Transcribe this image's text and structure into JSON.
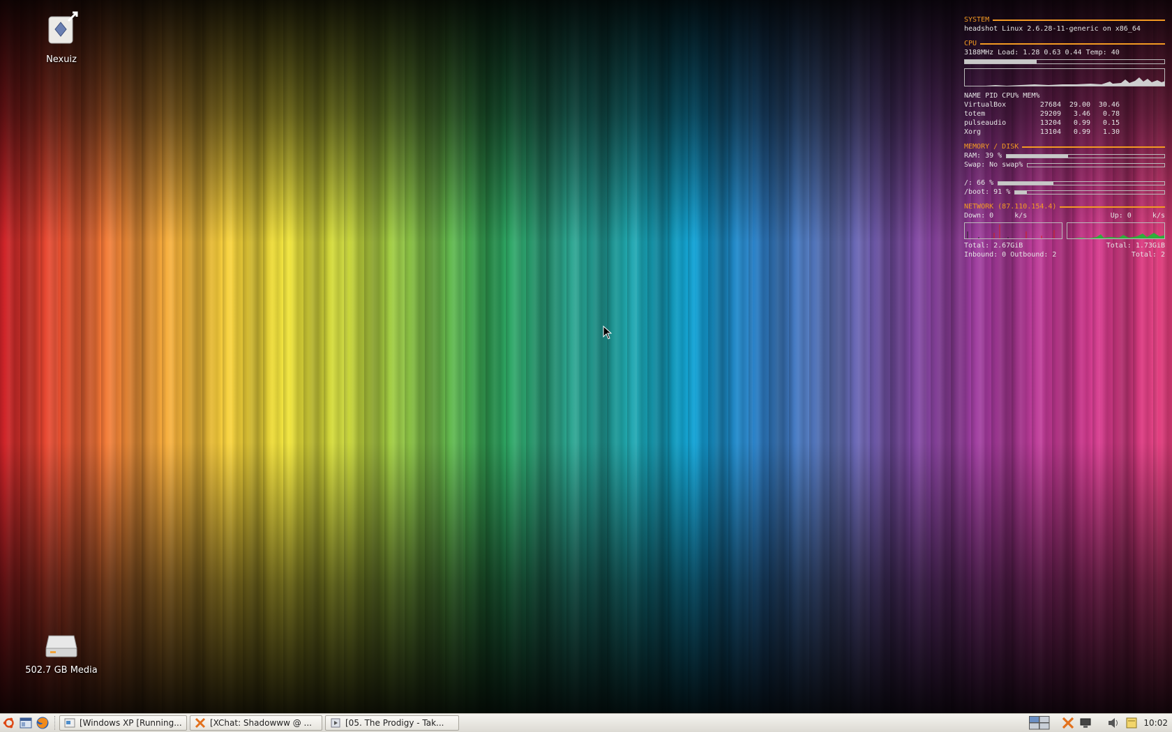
{
  "desktop": {
    "icons": [
      {
        "label": "Nexuiz"
      },
      {
        "label": "502.7 GB Media"
      }
    ]
  },
  "conky": {
    "system": {
      "heading": "SYSTEM",
      "line": "headshot Linux 2.6.28-11-generic on x86_64"
    },
    "cpu": {
      "heading": "CPU",
      "line": "3188MHz Load: 1.28 0.63 0.44 Temp: 40",
      "usage_fraction": 0.36,
      "process_header": "NAME PID CPU% MEM%",
      "processes": [
        {
          "name": "VirtualBox",
          "pid": "27684",
          "cpu": "29.00",
          "mem": "30.46"
        },
        {
          "name": "totem",
          "pid": "29209",
          "cpu": "3.46",
          "mem": "0.78"
        },
        {
          "name": "pulseaudio",
          "pid": "13204",
          "cpu": "0.99",
          "mem": "0.15"
        },
        {
          "name": "Xorg",
          "pid": "13104",
          "cpu": "0.99",
          "mem": "1.30"
        }
      ]
    },
    "memory": {
      "heading": "MEMORY / DISK",
      "ram_label": "RAM: 39 %",
      "ram_fraction": 0.39,
      "swap_label": "Swap: No swap%",
      "swap_fraction": 0,
      "root_label": "/: 66 %",
      "root_fraction": 0.33,
      "boot_label": "/boot: 91 %",
      "boot_fraction": 0.08
    },
    "network": {
      "heading": "NETWORK (87.110.154.4)",
      "down_label": "Down: 0     k/s",
      "up_label": "Up: 0     k/s",
      "total_down": "Total: 2.67GiB",
      "total_up": "Total: 1.73GiB",
      "inbound_outbound": "Inbound: 0 Outbound: 2",
      "total_connections": "Total: 2"
    }
  },
  "taskbar": {
    "tasks": [
      {
        "label": "[Windows XP [Running..."
      },
      {
        "label": "[XChat: Shadowww @ ..."
      },
      {
        "label": "[05. The Prodigy - Tak..."
      }
    ],
    "clock": "10:02",
    "colors": {
      "conky_accent": "#f39a22",
      "down_graph": "#d42020",
      "up_graph": "#2fae3a"
    }
  }
}
